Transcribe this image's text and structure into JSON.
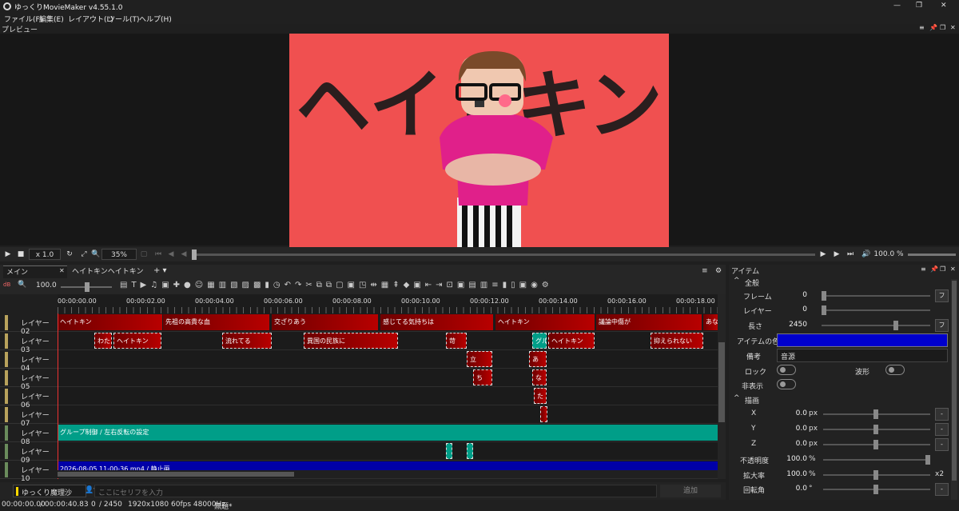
{
  "app": {
    "title": "ゆっくりMovieMaker v4.55.1.0",
    "window_controls": [
      "—",
      "❐",
      "✕"
    ]
  },
  "menu": [
    "ファイル(F)",
    "編集(E)",
    "レイアウト(L)",
    "ツール(T)",
    "ヘルプ(H)"
  ],
  "preview": {
    "header": "プレビュー",
    "title_text": "ヘイトキン",
    "canvas_color": "#f05050"
  },
  "transport": {
    "speed": "x 1.0",
    "zoom": "35%",
    "volume": "100.0 %"
  },
  "tabs": [
    "メイン",
    "ヘイトキンヘイトキン"
  ],
  "timeline": {
    "zoom": "100.0",
    "db_label": "dB",
    "ruler": [
      "00:00:00.00",
      "00:00:02.00",
      "00:00:04.00",
      "00:00:06.00",
      "00:00:08.00",
      "00:00:10.00",
      "00:00:12.00",
      "00:00:14.00",
      "00:00:16.00",
      "00:00:18.00"
    ],
    "layers": [
      "レイヤー 02",
      "レイヤー 03",
      "レイヤー 04",
      "レイヤー 05",
      "レイヤー 06",
      "レイヤー 07",
      "レイヤー 08",
      "レイヤー 09",
      "レイヤー 10"
    ],
    "clips": {
      "l02": [
        "ヘイトキン",
        "先祖の高貴な血",
        "交ざりあう",
        "感じてる気持ちは",
        "ヘイトキン",
        "議論中傷が",
        "あな"
      ],
      "l03": [
        "わた",
        "ヘイトキン",
        "流れてる",
        "異国の民族に",
        "苛",
        "グル",
        "ヘイトキン",
        "抑えられない"
      ],
      "l04": [
        "立",
        "あ"
      ],
      "l05": [
        "ち",
        "な"
      ],
      "l06": [
        "た"
      ],
      "l08": "グループ制御 / 左右反転の設定",
      "l10": "2026-08-05 11-00-36.mp4 / 静止画"
    }
  },
  "bottom": {
    "speaker": "ゆっくり魔理沙",
    "input_placeholder": "ここにセリフを入力",
    "add_button": "追加"
  },
  "status": {
    "time": "00:00:00.00",
    "duration": "/ 00:00:40.83",
    "frame": "0",
    "frames": "/ 2450",
    "format": "1920x1080 60fps 48000Hz",
    "project": "無題*"
  },
  "item_panel": {
    "title": "アイテム",
    "section_general": "全般",
    "frame_label": "フレーム",
    "frame_value": "0",
    "layer_label": "レイヤー",
    "layer_value": "0",
    "length_label": "長さ",
    "length_value": "2450",
    "color_label": "アイテムの色",
    "color_value": "#0000cc",
    "memo_label": "備考",
    "memo_value": "音源",
    "lock_label": "ロック",
    "wave_label": "波形",
    "hide_label": "非表示",
    "section_draw": "描画",
    "x_label": "X",
    "x_value": "0.0",
    "y_label": "Y",
    "y_value": "0.0",
    "z_label": "Z",
    "z_value": "0.0",
    "unit_px": "px",
    "opacity_label": "不透明度",
    "opacity_value": "100.0",
    "unit_pct": "%",
    "scale_label": "拡大率",
    "scale_value": "100.0",
    "scale_suffix": "x2",
    "rotate_label": "回転角",
    "rotate_value": "0.0",
    "unit_deg": "°",
    "f_button": "フ",
    "minus_button": "-"
  }
}
